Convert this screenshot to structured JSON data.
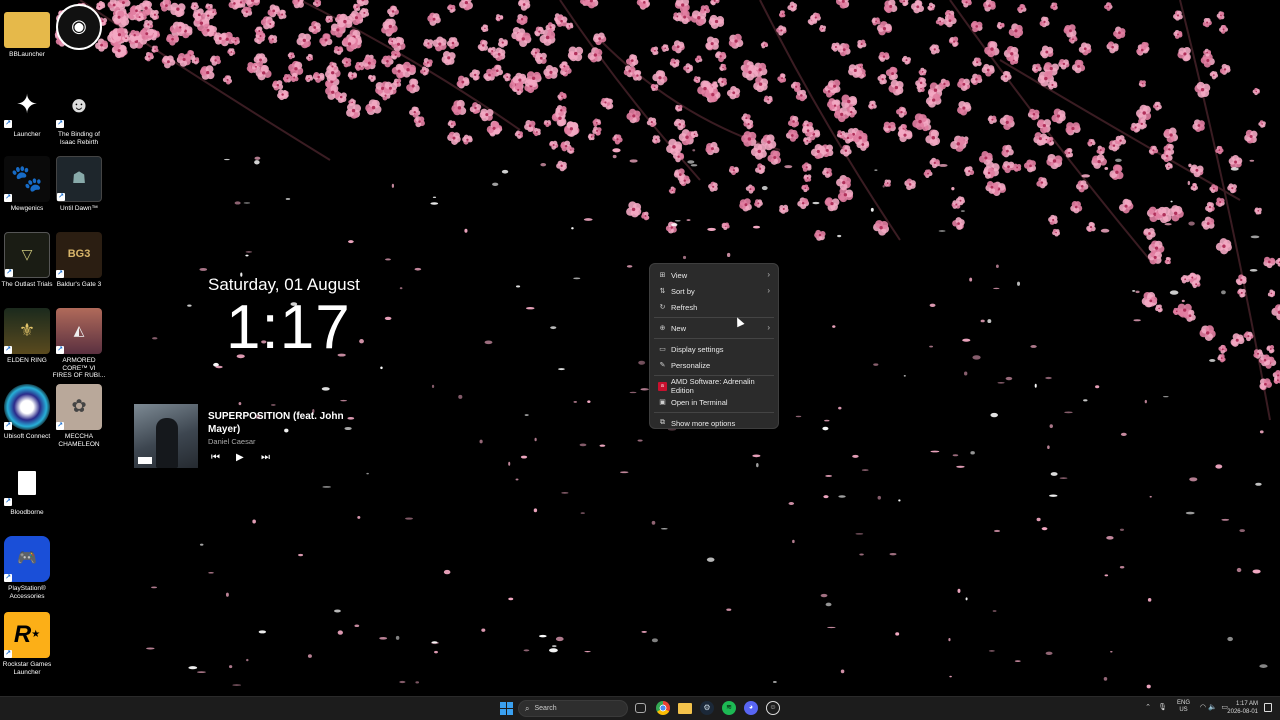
{
  "desktop": {
    "icons": [
      {
        "label": "BBLauncher",
        "icon": "folder-icon"
      },
      {
        "label": "",
        "icon": "eye-shield-icon"
      },
      {
        "label": "Launcher",
        "icon": "windows-launcher-icon"
      },
      {
        "label": "The Binding of Isaac Rebirth",
        "icon": "isaac-icon"
      },
      {
        "label": "Mewgenics",
        "icon": "paw-icon"
      },
      {
        "label": "Until Dawn™",
        "icon": "until-dawn-icon"
      },
      {
        "label": "The Outlast Trials",
        "icon": "outlast-icon"
      },
      {
        "label": "Baldur's Gate 3",
        "icon": "baldurs-gate-icon"
      },
      {
        "label": "ELDEN RING",
        "icon": "elden-ring-icon"
      },
      {
        "label": "ARMORED CORE™ VI FIRES OF RUBI...",
        "icon": "armored-core-icon"
      },
      {
        "label": "Ubisoft Connect",
        "icon": "ubisoft-icon"
      },
      {
        "label": "MECCHA CHAMELEON",
        "icon": "chameleon-icon"
      },
      {
        "label": "Bloodborne",
        "icon": "file-icon"
      },
      {
        "label": "PlayStation® Accessories",
        "icon": "playstation-controller-icon"
      },
      {
        "label": "Rockstar Games Launcher",
        "icon": "rockstar-icon"
      }
    ]
  },
  "clock": {
    "date": "Saturday, 01 August",
    "time": "1:17"
  },
  "media": {
    "title": "SUPERPOSITION (feat. John Mayer)",
    "artist": "Daniel Caesar",
    "prev_glyph": "⏮",
    "play_glyph": "▶",
    "next_glyph": "⏭"
  },
  "context_menu": {
    "items": [
      {
        "label": "View",
        "icon": "grid-view-icon",
        "submenu": true
      },
      {
        "label": "Sort by",
        "icon": "sort-icon",
        "submenu": true
      },
      {
        "label": "Refresh",
        "icon": "refresh-icon",
        "submenu": false
      },
      {
        "label": "New",
        "icon": "new-plus-icon",
        "submenu": true
      },
      {
        "label": "Display settings",
        "icon": "display-icon",
        "submenu": false
      },
      {
        "label": "Personalize",
        "icon": "pen-icon",
        "submenu": false
      },
      {
        "label": "AMD Software: Adrenalin Edition",
        "icon": "amd-icon",
        "submenu": false
      },
      {
        "label": "Open in Terminal",
        "icon": "terminal-icon",
        "submenu": false
      },
      {
        "label": "Show more options",
        "icon": "more-options-icon",
        "submenu": false
      }
    ]
  },
  "taskbar": {
    "search_placeholder": "Search",
    "apps": [
      "task-view-icon",
      "chrome-icon",
      "file-explorer-icon",
      "steam-icon",
      "spotify-icon",
      "discord-icon",
      "app-icon"
    ],
    "lang_line1": "ENG",
    "lang_line2": "US",
    "time": "1:17 AM",
    "date": "2026-08-01"
  },
  "colors": {
    "blossom": "#f3a9c3",
    "blossom_dark": "#e27ea2",
    "menu_bg": "#2b2b2b",
    "taskbar_bg": "#1c1c1c",
    "accent": "#3aa0f0"
  }
}
